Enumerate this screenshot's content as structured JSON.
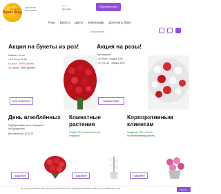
{
  "header": {
    "logo_text": "Букет Шоу",
    "tagline": "Цветочная мастерская",
    "address_1": "ул. ...",
    "address_2": "Жуковского ...",
    "phone_1": "+7 (...)",
    "phone_2": "Доставка ...",
    "callback_label": "Перезвоните мне",
    "nav": [
      "Розы",
      "Букеты",
      "Цветы",
      "Композиции",
      "Дополнить букет"
    ],
    "nav_second": "Хиты сезона"
  },
  "promo_left": {
    "title": "Акция на букеты из роз!",
    "line1": "Начало: 40 см",
    "line2": "с 13.04 по 30.05",
    "price_1": "51 роза - 5990 рублей",
    "price_2": "101 роза - 9990 рублей",
    "button": "Хочу посмотреть"
  },
  "promo_right": {
    "title": "Акция на розы!",
    "line1": "При покупке",
    "line2": "- от 51шт - скидка 10%",
    "line3": "- от 101 шт - скидка 15%",
    "button": "Заказать букет"
  },
  "cards": [
    {
      "title": "День влюблённых",
      "text_1": "Подборка букетов к 14 февраля.",
      "text_2": "Не пропустите!",
      "text_3": "Для заказа до 10.02.20",
      "button": "Подробнее"
    },
    {
      "title": "Комнатные растения",
      "text_1": "Скидка 10% на все растения",
      "text_2": "в горшках",
      "button": "Подробнее"
    },
    {
      "title": "Корпоративным клиентам",
      "text_1": "Скидки до 15%, оплата",
      "text_2": "по безналичному расчету",
      "button": "Подробнее"
    }
  ],
  "cookie": {
    "text": "Мы используем файлы cookie для улучшения работы сайта. Продолжая пользоваться сайтом, вы соглашаетесь с этим.",
    "button": "Принять"
  },
  "colors": {
    "accent": "#8f4fd8",
    "red": "#e0363a",
    "green": "#2a9a3a"
  }
}
